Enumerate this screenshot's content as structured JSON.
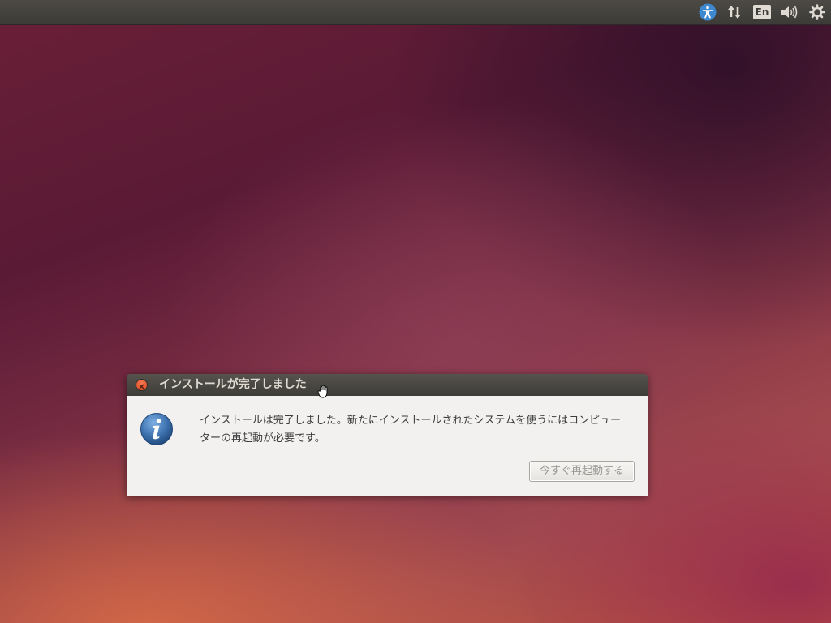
{
  "panel": {
    "language_indicator": "En",
    "icons": [
      "accessibility-icon",
      "network-icon",
      "keyboard-language-icon",
      "volume-icon",
      "power-settings-icon"
    ]
  },
  "dialog": {
    "title": "インストールが完了しました",
    "message_line1": "インストールは完了しました。新たにインストールされたシステムを使うにはコンピュー",
    "message_line2": "ターの再起動が必要です。",
    "restart_button_label": "今すぐ再起動する",
    "icon": "info-icon"
  },
  "colors": {
    "panel": "#3c3b37",
    "close_button": "#e05a2c",
    "dialog_body": "#f2f1f0",
    "info_icon": "#3d73b0"
  }
}
